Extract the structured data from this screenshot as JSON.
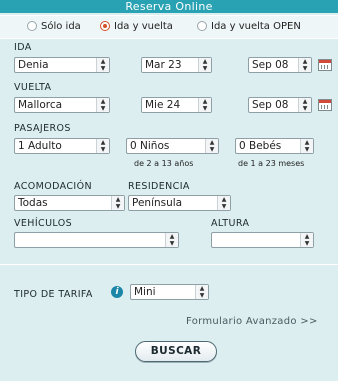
{
  "header": {
    "title": "Reserva Online"
  },
  "trip_type": {
    "options": [
      "Sólo ida",
      "Ida y vuelta",
      "Ida y vuelta OPEN"
    ],
    "selected": "Ida y vuelta"
  },
  "ida": {
    "label": "IDA",
    "origin": "Denia",
    "date": "Mar 23",
    "month": "Sep 08"
  },
  "vuelta": {
    "label": "VUELTA",
    "origin": "Mallorca",
    "date": "Mie 24",
    "month": "Sep 08"
  },
  "pasajeros": {
    "label": "PASAJEROS",
    "adults": "1 Adulto",
    "children": "0 Niños",
    "children_note": "de 2 a 13 años",
    "babies": "0 Bebés",
    "babies_note": "de 1 a 23 meses"
  },
  "acomodacion": {
    "label": "ACOMODACIÓN",
    "value": "Todas"
  },
  "residencia": {
    "label": "RESIDENCIA",
    "value": "Península"
  },
  "vehiculos": {
    "label": "VEHÍCULOS",
    "value": ""
  },
  "altura": {
    "label": "ALTURA",
    "value": ""
  },
  "tarifa": {
    "label": "TIPO DE TARIFA",
    "value": "Mini",
    "info_icon": "i"
  },
  "advanced_link": "Formulario Avanzado >>",
  "submit_label": "BUSCAR",
  "colors": {
    "header": "#29a3b4",
    "background": "#dceef0",
    "radio_accent": "#d4502a",
    "info": "#1c86a8"
  }
}
